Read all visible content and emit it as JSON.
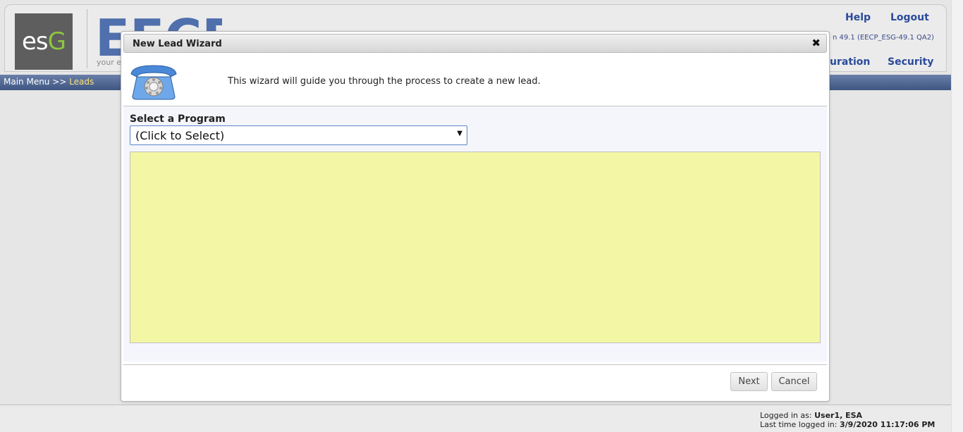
{
  "header": {
    "logo_text": "esg",
    "tagline": "your en",
    "help": "Help",
    "logout": "Logout",
    "version": "n 49.1 (EECP_ESG-49.1 QA2)",
    "nav_configuration": "uration",
    "nav_security": "Security"
  },
  "breadcrumb": {
    "main": "Main Menu",
    "separator": ">>",
    "current": "Leads"
  },
  "modal": {
    "title": "New Lead Wizard",
    "close": "✖",
    "intro": "This wizard will guide you through the process to create a new lead.",
    "program_label": "Select a Program",
    "program_value": "(Click to Select)",
    "next": "Next",
    "cancel": "Cancel"
  },
  "footer": {
    "logged_in_label": "Logged in as:",
    "logged_in_user": "User1, ESA",
    "last_login_label": "Last time logged in:",
    "last_login_value": "3/9/2020 11:17:06 PM"
  },
  "colors": {
    "brand_blue": "#2a4a9b",
    "crumb_bar": "#4a5f8c",
    "panel_yellow": "#f3f6a4",
    "logo_green": "#8ec63f"
  },
  "icons": [
    "phone-icon",
    "close-icon",
    "dropdown-arrow-icon"
  ]
}
